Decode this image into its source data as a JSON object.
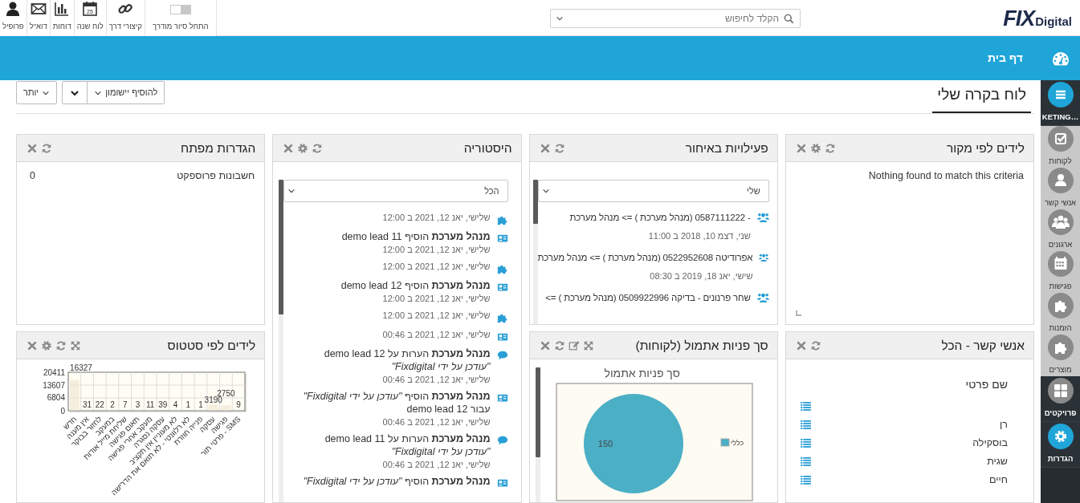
{
  "logo": {
    "mark": "FIX",
    "word": "Digital"
  },
  "search": {
    "placeholder": "הקלד לחיפוש"
  },
  "toolbar": [
    {
      "kind": "toggle",
      "label": "התחל סיור מודרך",
      "on": false
    },
    {
      "kind": "link",
      "label": "קיצורי דרך"
    },
    {
      "kind": "calendar",
      "label": "לוח שנה",
      "icon_text": "25"
    },
    {
      "kind": "reports",
      "label": "דוחות"
    },
    {
      "kind": "mail",
      "label": "דוא\"ל"
    },
    {
      "kind": "profile",
      "label": "פרופיל"
    }
  ],
  "banner": {
    "title": "דף בית"
  },
  "sidebar": {
    "sections": [
      {
        "kind": "dark",
        "items": [
          {
            "kind": "menu",
            "active": true,
            "label": "…KETING"
          }
        ]
      },
      {
        "kind": "light",
        "items": [
          {
            "kind": "check",
            "active": false,
            "label": "לקוחות"
          },
          {
            "kind": "person",
            "active": false,
            "label": "אנשי קשר"
          },
          {
            "kind": "group",
            "active": false,
            "label": "ארגונים"
          },
          {
            "kind": "calendar",
            "active": false,
            "label": "פגישות"
          },
          {
            "kind": "puzzle",
            "active": false,
            "label": "הזמנות"
          },
          {
            "kind": "puzzle",
            "active": false,
            "label": "מוצרים"
          }
        ]
      },
      {
        "kind": "dark",
        "items": [
          {
            "kind": "grid",
            "active": false,
            "label": "פרויקטים"
          },
          {
            "kind": "gear",
            "active": true,
            "label": "הגדרות"
          }
        ]
      }
    ]
  },
  "page": {
    "title": "לוח בקרה שלי",
    "add_button": "להוסיף יישומון",
    "more_button": "יותר"
  },
  "widgets": [
    {
      "kind": "message",
      "title": "לידים לפי מקור",
      "tools": [
        {
          "kind": "close"
        },
        {
          "kind": "settings"
        },
        {
          "kind": "refresh"
        }
      ],
      "message": "Nothing found to match this criteria"
    },
    {
      "kind": "activities",
      "title": "פעילויות באיחור",
      "tools": [
        {
          "kind": "close"
        },
        {
          "kind": "refresh"
        }
      ],
      "filter": "שלי",
      "items": [
        {
          "text": "- 0587111222 (מנהל מערכת ) => מנהל מערכת",
          "date": "שני, דצמ 10, 2018 ב 11:00"
        },
        {
          "text": "אפרודיטה 0522952608 (מנהל מערכת ) => מנהל מערכת",
          "date": "שישי, יאנ 18, 2019 ב 08:30"
        },
        {
          "text": "שחר פרנונים - בדיקה 0509922996 (מנהל מערכת ) =>"
        }
      ]
    },
    {
      "kind": "history",
      "title": "היסטוריה",
      "tools": [
        {
          "kind": "close"
        },
        {
          "kind": "settings"
        },
        {
          "kind": "refresh"
        }
      ],
      "tall": true,
      "filter": "הכל",
      "entries": [
        {
          "kind": "puzzle",
          "date": "שלישי, יאנ 12, 2021 ב 12:00"
        },
        {
          "kind": "card",
          "text": "**מנהל מערכת** הוסיף demo lead 11",
          "date": "שלישי, יאנ 12, 2021 ב 12:00"
        },
        {
          "kind": "puzzle",
          "date": "שלישי, יאנ 12, 2021 ב 12:00"
        },
        {
          "kind": "card",
          "text": "**מנהל מערכת** הוסיף demo lead 12",
          "date": "שלישי, יאנ 12, 2021 ב 12:00"
        },
        {
          "kind": "puzzle",
          "date": "שלישי, יאנ 12, 2021 ב 12:00"
        },
        {
          "kind": "card",
          "date": "שלישי, יאנ 12, 2021 ב 00:46"
        },
        {
          "kind": "comment",
          "text": "**מנהל מערכת** הערות על demo lead 12",
          "note": "\"עודכן על ידי Fixdigital\"",
          "date": "שלישי, יאנ 12, 2021 ב 00:46"
        },
        {
          "kind": "card",
          "text": "**מנהל מערכת** הוסיף *\"עודכן על ידי Fixdigital\"*",
          "sub": "עבור demo lead 12",
          "date": "שלישי, יאנ 12, 2021 ב 00:46"
        },
        {
          "kind": "comment",
          "text": "**מנהל מערכת** הערות על demo lead 11",
          "note": "\"עודכן על ידי Fixdigital\"",
          "date": "שלישי, יאנ 12, 2021 ב 00:46"
        },
        {
          "kind": "card",
          "text": "**מנהל מערכת** הוסיף *\"עודכן על ידי Fixdigital\"*"
        }
      ]
    },
    {
      "kind": "stats",
      "title": "הגדרות מפתח",
      "tools": [
        {
          "kind": "close"
        },
        {
          "kind": "refresh"
        }
      ],
      "rows": [
        {
          "label": "חשבונות פרוספקט",
          "value": "0"
        }
      ]
    },
    {
      "kind": "contacts",
      "title": "אנשי קשר - הכל",
      "tools": [
        {
          "kind": "close"
        },
        {
          "kind": "refresh"
        }
      ],
      "column": "שם פרטי",
      "rows": [
        {},
        {
          "name": "רן"
        },
        {
          "name": "בוסקילה"
        },
        {
          "name": "שגית"
        },
        {
          "name": "חיים"
        }
      ]
    },
    {
      "kind": "chart",
      "title": "סך פניות אתמול (לקוחות)",
      "tools": [
        {
          "kind": "close"
        },
        {
          "kind": "refresh"
        },
        {
          "kind": "edit"
        },
        {
          "kind": "expand"
        }
      ],
      "chart_data": {
        "type": "pie",
        "title": "סך פניות אתמול",
        "categories": [
          "כללי"
        ],
        "values": [
          150
        ],
        "data_labels": true
      }
    },
    {
      "kind": "chart",
      "title": "לידים לפי סטטוס",
      "tools": [
        {
          "kind": "close"
        },
        {
          "kind": "settings"
        },
        {
          "kind": "refresh"
        },
        {
          "kind": "expand"
        }
      ],
      "chart_data": {
        "type": "bar",
        "categories": [
          "חדש",
          "אין מענה",
          "לחזור בבוקר",
          "במעקב",
          "שליחת מייל אודות",
          "תאום פגישה",
          "מעקב אחרי פגישה",
          "עסקה נסגרה",
          "לא מעוניין אין תקציב",
          "לא רלוונטי - לא תואם את הדרישה",
          "פנייה חוזרת",
          "עסקה",
          "פגישה",
          "פרטי תור - SMS"
        ],
        "values": [
          16327,
          31,
          22,
          2,
          7,
          3,
          11,
          39,
          4,
          1,
          1,
          3190,
          2750,
          9
        ],
        "ylim": [
          0,
          20411
        ],
        "yticks": [
          0,
          6804,
          13607,
          20411
        ],
        "data_labels": true
      }
    }
  ]
}
